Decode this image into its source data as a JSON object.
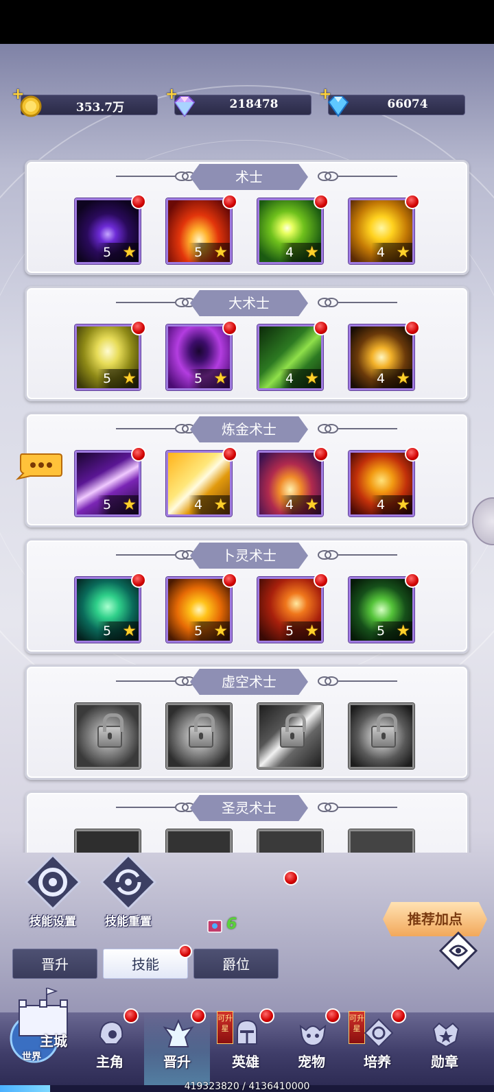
{
  "currencies": [
    {
      "icon": "gold-coin-icon",
      "value": "353.7万"
    },
    {
      "icon": "rainbow-diamond-icon",
      "value": "218478"
    },
    {
      "icon": "blue-diamond-icon",
      "value": "66074"
    }
  ],
  "panels": [
    {
      "title": "术士",
      "skills": [
        {
          "icon": "dark-orb-skill-icon",
          "level": "5",
          "locked": false,
          "red_dot": true
        },
        {
          "icon": "fire-burst-skill-icon",
          "level": "5",
          "locked": false,
          "red_dot": true
        },
        {
          "icon": "green-flash-skill-icon",
          "level": "4",
          "locked": false,
          "red_dot": true
        },
        {
          "icon": "golden-shield-skill-icon",
          "level": "4",
          "locked": false,
          "red_dot": true
        }
      ]
    },
    {
      "title": "大术士",
      "skills": [
        {
          "icon": "yellow-vortex-skill-icon",
          "level": "5",
          "locked": false,
          "red_dot": true
        },
        {
          "icon": "shadow-figure-skill-icon",
          "level": "5",
          "locked": false,
          "red_dot": true
        },
        {
          "icon": "green-spirit-skill-icon",
          "level": "4",
          "locked": false,
          "red_dot": true
        },
        {
          "icon": "golden-wings-skill-icon",
          "level": "4",
          "locked": false,
          "red_dot": true
        }
      ]
    },
    {
      "title": "炼金术士",
      "skills": [
        {
          "icon": "purple-slash-skill-icon",
          "level": "5",
          "locked": false,
          "red_dot": true
        },
        {
          "icon": "golden-swirl-skill-icon",
          "level": "4",
          "locked": false,
          "red_dot": true
        },
        {
          "icon": "meditating-monk-skill-icon",
          "level": "4",
          "locked": false,
          "red_dot": true
        },
        {
          "icon": "flame-shield-skill-icon",
          "level": "4",
          "locked": false,
          "red_dot": true
        }
      ]
    },
    {
      "title": "卜灵术士",
      "skills": [
        {
          "icon": "green-clover-skill-icon",
          "level": "5",
          "locked": false,
          "red_dot": true
        },
        {
          "icon": "orange-spiral-skill-icon",
          "level": "5",
          "locked": false,
          "red_dot": true
        },
        {
          "icon": "lightning-strike-skill-icon",
          "level": "5",
          "locked": false,
          "red_dot": true
        },
        {
          "icon": "green-wind-skill-icon",
          "level": "5",
          "locked": false,
          "red_dot": true
        }
      ]
    },
    {
      "title": "虚空术士",
      "skills": [
        {
          "icon": "locked-rune-skill-icon",
          "level": "",
          "locked": true,
          "red_dot": false
        },
        {
          "icon": "locked-swirl-skill-icon",
          "level": "",
          "locked": true,
          "red_dot": false
        },
        {
          "icon": "locked-slash-skill-icon",
          "level": "",
          "locked": true,
          "red_dot": false
        },
        {
          "icon": "locked-galaxy-skill-icon",
          "level": "",
          "locked": true,
          "red_dot": false
        }
      ]
    },
    {
      "title": "圣灵术士",
      "skills": []
    }
  ],
  "actions": {
    "skill_settings": "技能设置",
    "skill_reset": "技能重置",
    "recommend": "推荐加点",
    "skill_books": "6"
  },
  "tabs": [
    {
      "label": "晋升",
      "active": false,
      "red_dot": false
    },
    {
      "label": "技能",
      "active": true,
      "red_dot": true
    },
    {
      "label": "爵位",
      "active": false,
      "red_dot": false
    }
  ],
  "nav": {
    "castle": "主城",
    "world": "世界",
    "items": [
      {
        "label": "主角",
        "icon": "hero-helmet-icon",
        "red_dot": true,
        "upgradable": false,
        "active": false
      },
      {
        "label": "晋升",
        "icon": "promotion-wings-icon",
        "red_dot": true,
        "upgradable": false,
        "active": true
      },
      {
        "label": "英雄",
        "icon": "knight-helmet-icon",
        "red_dot": true,
        "upgradable": true,
        "active": false
      },
      {
        "label": "宠物",
        "icon": "pet-dragon-icon",
        "red_dot": true,
        "upgradable": false,
        "active": false
      },
      {
        "label": "培养",
        "icon": "cultivate-gear-icon",
        "red_dot": true,
        "upgradable": true,
        "active": false
      },
      {
        "label": "勋章",
        "icon": "medal-star-icon",
        "red_dot": false,
        "upgradable": false,
        "active": false
      }
    ],
    "upgradable_label": "可升星"
  },
  "experience": {
    "text": "419323820 / 4136410000",
    "fraction": 0.101
  },
  "colors": {
    "accent": "#8e8fb4",
    "reddot": "#d10000",
    "star": "#ffd02a"
  }
}
